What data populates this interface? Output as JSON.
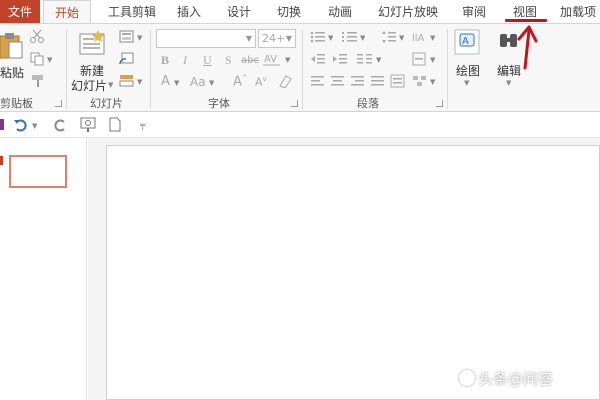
{
  "tabs": [
    {
      "label": "文件"
    },
    {
      "label": "开始"
    },
    {
      "label": "工具剪辑"
    },
    {
      "label": "插入"
    },
    {
      "label": "设计"
    },
    {
      "label": "切换"
    },
    {
      "label": "动画"
    },
    {
      "label": "幻灯片放映"
    },
    {
      "label": "审阅"
    },
    {
      "label": "视图"
    },
    {
      "label": "加载项"
    }
  ],
  "ribbon": {
    "clipboard": {
      "paste_label": "粘贴",
      "group_label": "剪贴板"
    },
    "slides": {
      "new_slide_line1": "新建",
      "new_slide_line2": "幻灯片",
      "group_label": "幻灯片"
    },
    "font": {
      "font_size": "24+",
      "group_label": "字体"
    },
    "paragraph": {
      "group_label": "段落"
    },
    "drawing": {
      "label": "绘图"
    },
    "editing": {
      "label": "编辑"
    }
  },
  "watermark": "头条@问答",
  "colors": {
    "accent": "#c0432a",
    "annotation": "#c0151c"
  }
}
